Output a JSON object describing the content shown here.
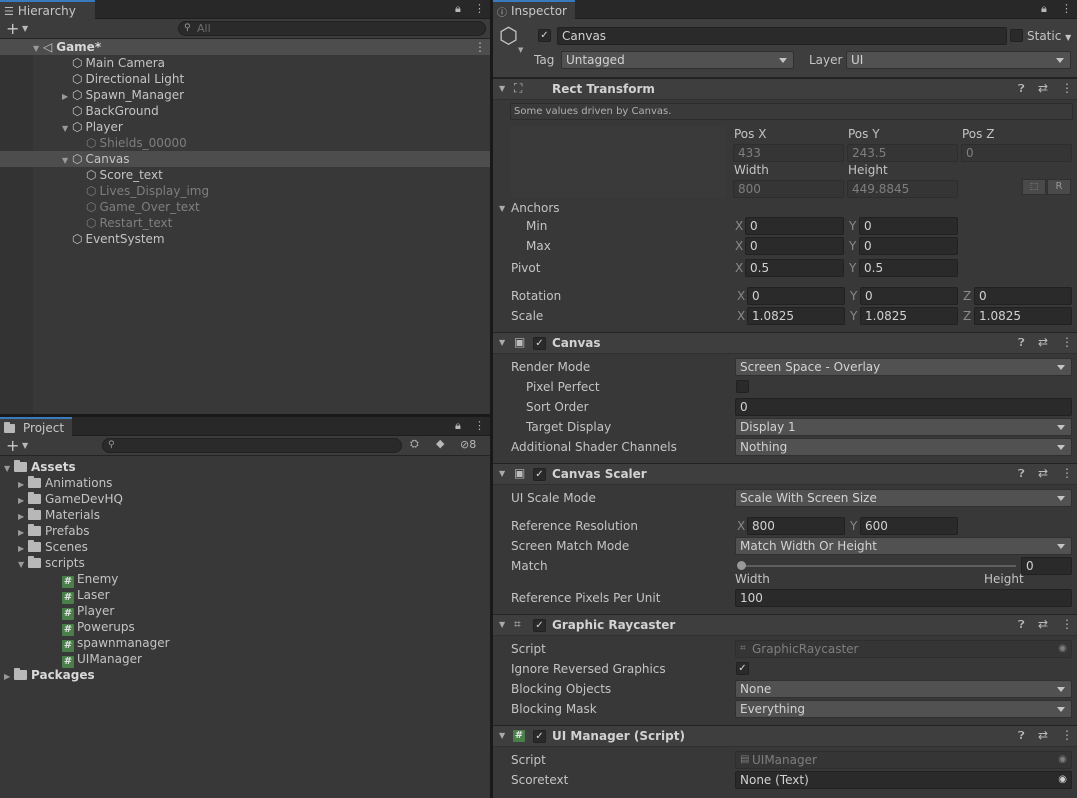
{
  "hierarchy": {
    "tab": "Hierarchy",
    "search_placeholder": "All",
    "items": [
      {
        "label": "Game*",
        "indent": 0,
        "kind": "scene",
        "arrow": "down",
        "sel": true,
        "dim": false
      },
      {
        "label": "Main Camera",
        "indent": 1,
        "kind": "cube",
        "arrow": "",
        "sel": false,
        "dim": false
      },
      {
        "label": "Directional Light",
        "indent": 1,
        "kind": "cube",
        "arrow": "",
        "sel": false,
        "dim": false
      },
      {
        "label": "Spawn_Manager",
        "indent": 1,
        "kind": "cube",
        "arrow": "right",
        "sel": false,
        "dim": false
      },
      {
        "label": "BackGround",
        "indent": 1,
        "kind": "cube",
        "arrow": "",
        "sel": false,
        "dim": false
      },
      {
        "label": "Player",
        "indent": 1,
        "kind": "cube",
        "arrow": "down",
        "sel": false,
        "dim": false
      },
      {
        "label": "Shields_00000",
        "indent": 2,
        "kind": "cube",
        "arrow": "",
        "sel": false,
        "dim": true
      },
      {
        "label": "Canvas",
        "indent": 1,
        "kind": "cube",
        "arrow": "down",
        "sel": true,
        "dim": false
      },
      {
        "label": "Score_text",
        "indent": 2,
        "kind": "cube",
        "arrow": "",
        "sel": false,
        "dim": false
      },
      {
        "label": "Lives_Display_img",
        "indent": 2,
        "kind": "cube",
        "arrow": "",
        "sel": false,
        "dim": true
      },
      {
        "label": "Game_Over_text",
        "indent": 2,
        "kind": "cube",
        "arrow": "",
        "sel": false,
        "dim": true
      },
      {
        "label": "Restart_text",
        "indent": 2,
        "kind": "cube",
        "arrow": "",
        "sel": false,
        "dim": true
      },
      {
        "label": "EventSystem",
        "indent": 1,
        "kind": "cube",
        "arrow": "",
        "sel": false,
        "dim": false
      }
    ]
  },
  "project": {
    "tab": "Project",
    "hidden_count": "8",
    "items": [
      {
        "label": "Assets",
        "indent": 0,
        "kind": "folder",
        "arrow": "down",
        "bold": true
      },
      {
        "label": "Animations",
        "indent": 1,
        "kind": "folder",
        "arrow": "right",
        "bold": false
      },
      {
        "label": "GameDevHQ",
        "indent": 1,
        "kind": "folder",
        "arrow": "right",
        "bold": false
      },
      {
        "label": "Materials",
        "indent": 1,
        "kind": "folder",
        "arrow": "right",
        "bold": false
      },
      {
        "label": "Prefabs",
        "indent": 1,
        "kind": "folder",
        "arrow": "right",
        "bold": false
      },
      {
        "label": "Scenes",
        "indent": 1,
        "kind": "folder",
        "arrow": "right",
        "bold": false
      },
      {
        "label": "scripts",
        "indent": 1,
        "kind": "folder",
        "arrow": "down",
        "bold": false
      },
      {
        "label": "Enemy",
        "indent": 2,
        "kind": "script",
        "arrow": "",
        "bold": false
      },
      {
        "label": "Laser",
        "indent": 2,
        "kind": "script",
        "arrow": "",
        "bold": false
      },
      {
        "label": "Player",
        "indent": 2,
        "kind": "script",
        "arrow": "",
        "bold": false
      },
      {
        "label": "Powerups",
        "indent": 2,
        "kind": "script",
        "arrow": "",
        "bold": false
      },
      {
        "label": "spawnmanager",
        "indent": 2,
        "kind": "script",
        "arrow": "",
        "bold": false
      },
      {
        "label": "UIManager",
        "indent": 2,
        "kind": "script",
        "arrow": "",
        "bold": false
      },
      {
        "label": "Packages",
        "indent": 0,
        "kind": "folder",
        "arrow": "right",
        "bold": true
      }
    ]
  },
  "inspector": {
    "tab": "Inspector",
    "object_name": "Canvas",
    "static_label": "Static",
    "tag_label": "Tag",
    "tag_value": "Untagged",
    "layer_label": "Layer",
    "layer_value": "UI",
    "rect": {
      "title": "Rect Transform",
      "note": "Some values driven by Canvas.",
      "posx_label": "Pos X",
      "posy_label": "Pos Y",
      "posz_label": "Pos Z",
      "posx": "433",
      "posy": "243.5",
      "posz": "0",
      "width_label": "Width",
      "height_label": "Height",
      "width": "800",
      "height": "449.8845",
      "r_label": "R",
      "anchors_label": "Anchors",
      "min_label": "Min",
      "max_label": "Max",
      "min_x": "0",
      "min_y": "0",
      "max_x": "0",
      "max_y": "0",
      "pivot_label": "Pivot",
      "pivot_x": "0.5",
      "pivot_y": "0.5",
      "rotation_label": "Rotation",
      "rot_x": "0",
      "rot_y": "0",
      "rot_z": "0",
      "scale_label": "Scale",
      "scale_x": "1.0825",
      "scale_y": "1.0825",
      "scale_z": "1.0825",
      "x": "X",
      "y": "Y",
      "z": "Z"
    },
    "canvas": {
      "title": "Canvas",
      "render_mode_label": "Render Mode",
      "render_mode": "Screen Space - Overlay",
      "pixel_perfect_label": "Pixel Perfect",
      "sort_order_label": "Sort Order",
      "sort_order": "0",
      "target_display_label": "Target Display",
      "target_display": "Display 1",
      "shader_channels_label": "Additional Shader Channels",
      "shader_channels": "Nothing"
    },
    "scaler": {
      "title": "Canvas Scaler",
      "ui_scale_mode_label": "UI Scale Mode",
      "ui_scale_mode": "Scale With Screen Size",
      "ref_res_label": "Reference Resolution",
      "ref_x": "800",
      "ref_y": "600",
      "match_mode_label": "Screen Match Mode",
      "match_mode": "Match Width Or Height",
      "match_label": "Match",
      "match_value": "0",
      "match_fraction": 0,
      "width_label": "Width",
      "height_label": "Height",
      "ppu_label": "Reference Pixels Per Unit",
      "ppu": "100"
    },
    "raycaster": {
      "title": "Graphic Raycaster",
      "script_label": "Script",
      "script": "GraphicRaycaster",
      "ignore_label": "Ignore Reversed Graphics",
      "blocking_objects_label": "Blocking Objects",
      "blocking_objects": "None",
      "blocking_mask_label": "Blocking Mask",
      "blocking_mask": "Everything"
    },
    "uimanager": {
      "title": "UI Manager (Script)",
      "script_label": "Script",
      "script": "UIManager",
      "scoretext_label": "Scoretext",
      "scoretext": "None (Text)"
    }
  }
}
